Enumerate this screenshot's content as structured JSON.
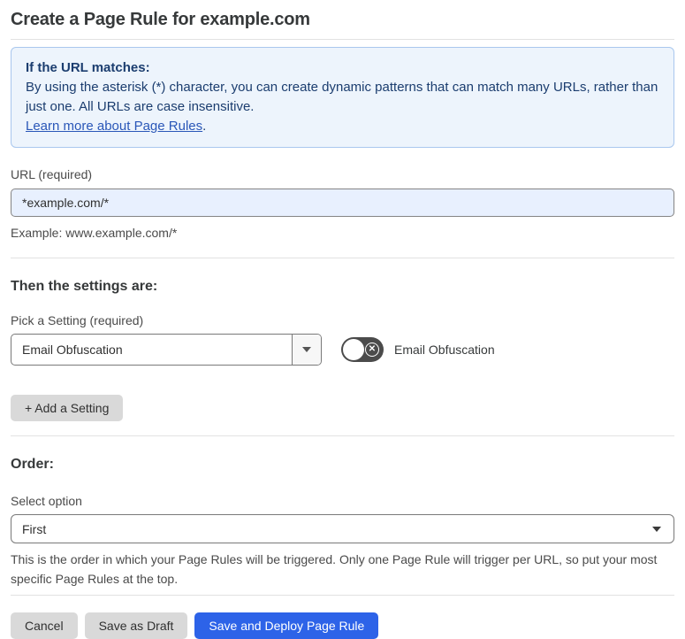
{
  "page": {
    "title": "Create a Page Rule for example.com"
  },
  "info_box": {
    "heading": "If the URL matches:",
    "body": "By using the asterisk (*) character, you can create dynamic patterns that can match many URLs, rather than just one. All URLs are case insensitive.",
    "link_label": "Learn more about Page Rules",
    "link_suffix": "."
  },
  "url_field": {
    "label": "URL (required)",
    "value": "*example.com/*",
    "helper": "Example: www.example.com/*"
  },
  "settings_section": {
    "heading": "Then the settings are:",
    "picker_label": "Pick a Setting (required)",
    "picker_value": "Email Obfuscation",
    "toggle_label": "Email Obfuscation",
    "toggle_state": "off",
    "toggle_off_glyph": "✕",
    "add_setting_label": "+ Add a Setting"
  },
  "order_section": {
    "heading": "Order:",
    "select_label": "Select option",
    "select_value": "First",
    "helper": "This is the order in which your Page Rules will be triggered. Only one Page Rule will trigger per URL, so put your most specific Page Rules at the top."
  },
  "footer": {
    "cancel_label": "Cancel",
    "save_draft_label": "Save as Draft",
    "save_deploy_label": "Save and Deploy Page Rule"
  },
  "colors": {
    "accent_blue": "#2D63E8",
    "info_bg": "#EDF4FC",
    "info_border": "#A9C7EE",
    "info_text": "#1B3D6F",
    "input_bg": "#E8F0FE",
    "toggle_off_bg": "#4B4B4B",
    "button_gray": "#D9D9D9"
  }
}
